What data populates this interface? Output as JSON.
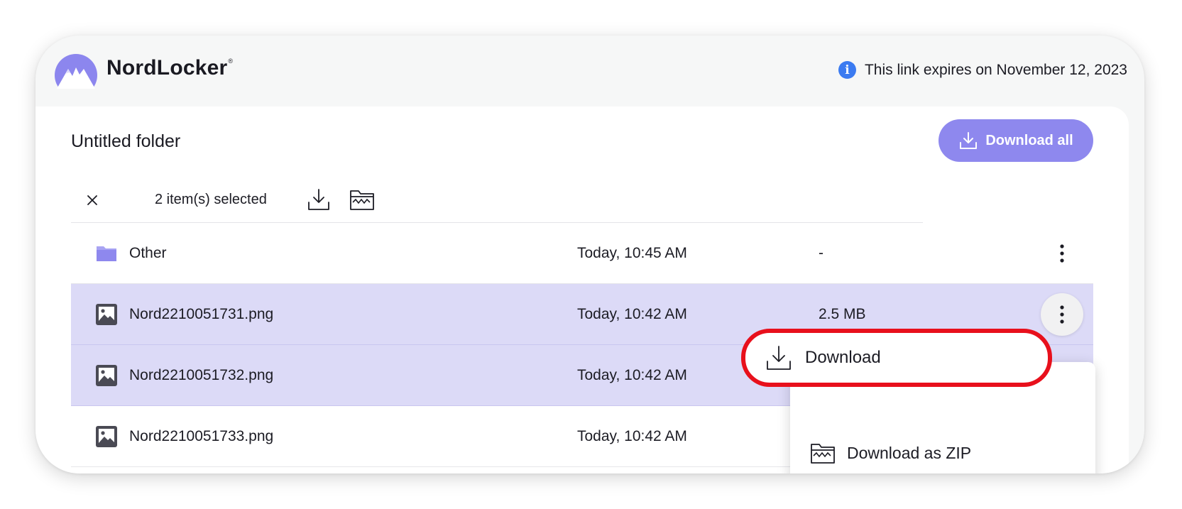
{
  "app": {
    "name": "NordLocker",
    "trademark": "®",
    "expiry_notice": "This link expires on November 12, 2023"
  },
  "folder": {
    "title": "Untitled folder",
    "download_all_label": "Download all"
  },
  "selection": {
    "count_label": "2 item(s) selected"
  },
  "files": [
    {
      "name": "Other",
      "type": "folder",
      "date": "Today, 10:45 AM",
      "size": "-",
      "selected": false
    },
    {
      "name": "Nord2210051731.png",
      "type": "image",
      "date": "Today, 10:42 AM",
      "size": "2.5 MB",
      "selected": true
    },
    {
      "name": "Nord2210051732.png",
      "type": "image",
      "date": "Today, 10:42 AM",
      "size": "",
      "selected": true
    },
    {
      "name": "Nord2210051733.png",
      "type": "image",
      "date": "Today, 10:42 AM",
      "size": "",
      "selected": false
    }
  ],
  "context_menu": {
    "download_label": "Download",
    "download_zip_label": "Download as ZIP"
  },
  "colors": {
    "accent": "#8e88ee",
    "selected_row": "#dcdaf7",
    "highlight_ring": "#e8101c",
    "info": "#3b7bf1"
  }
}
